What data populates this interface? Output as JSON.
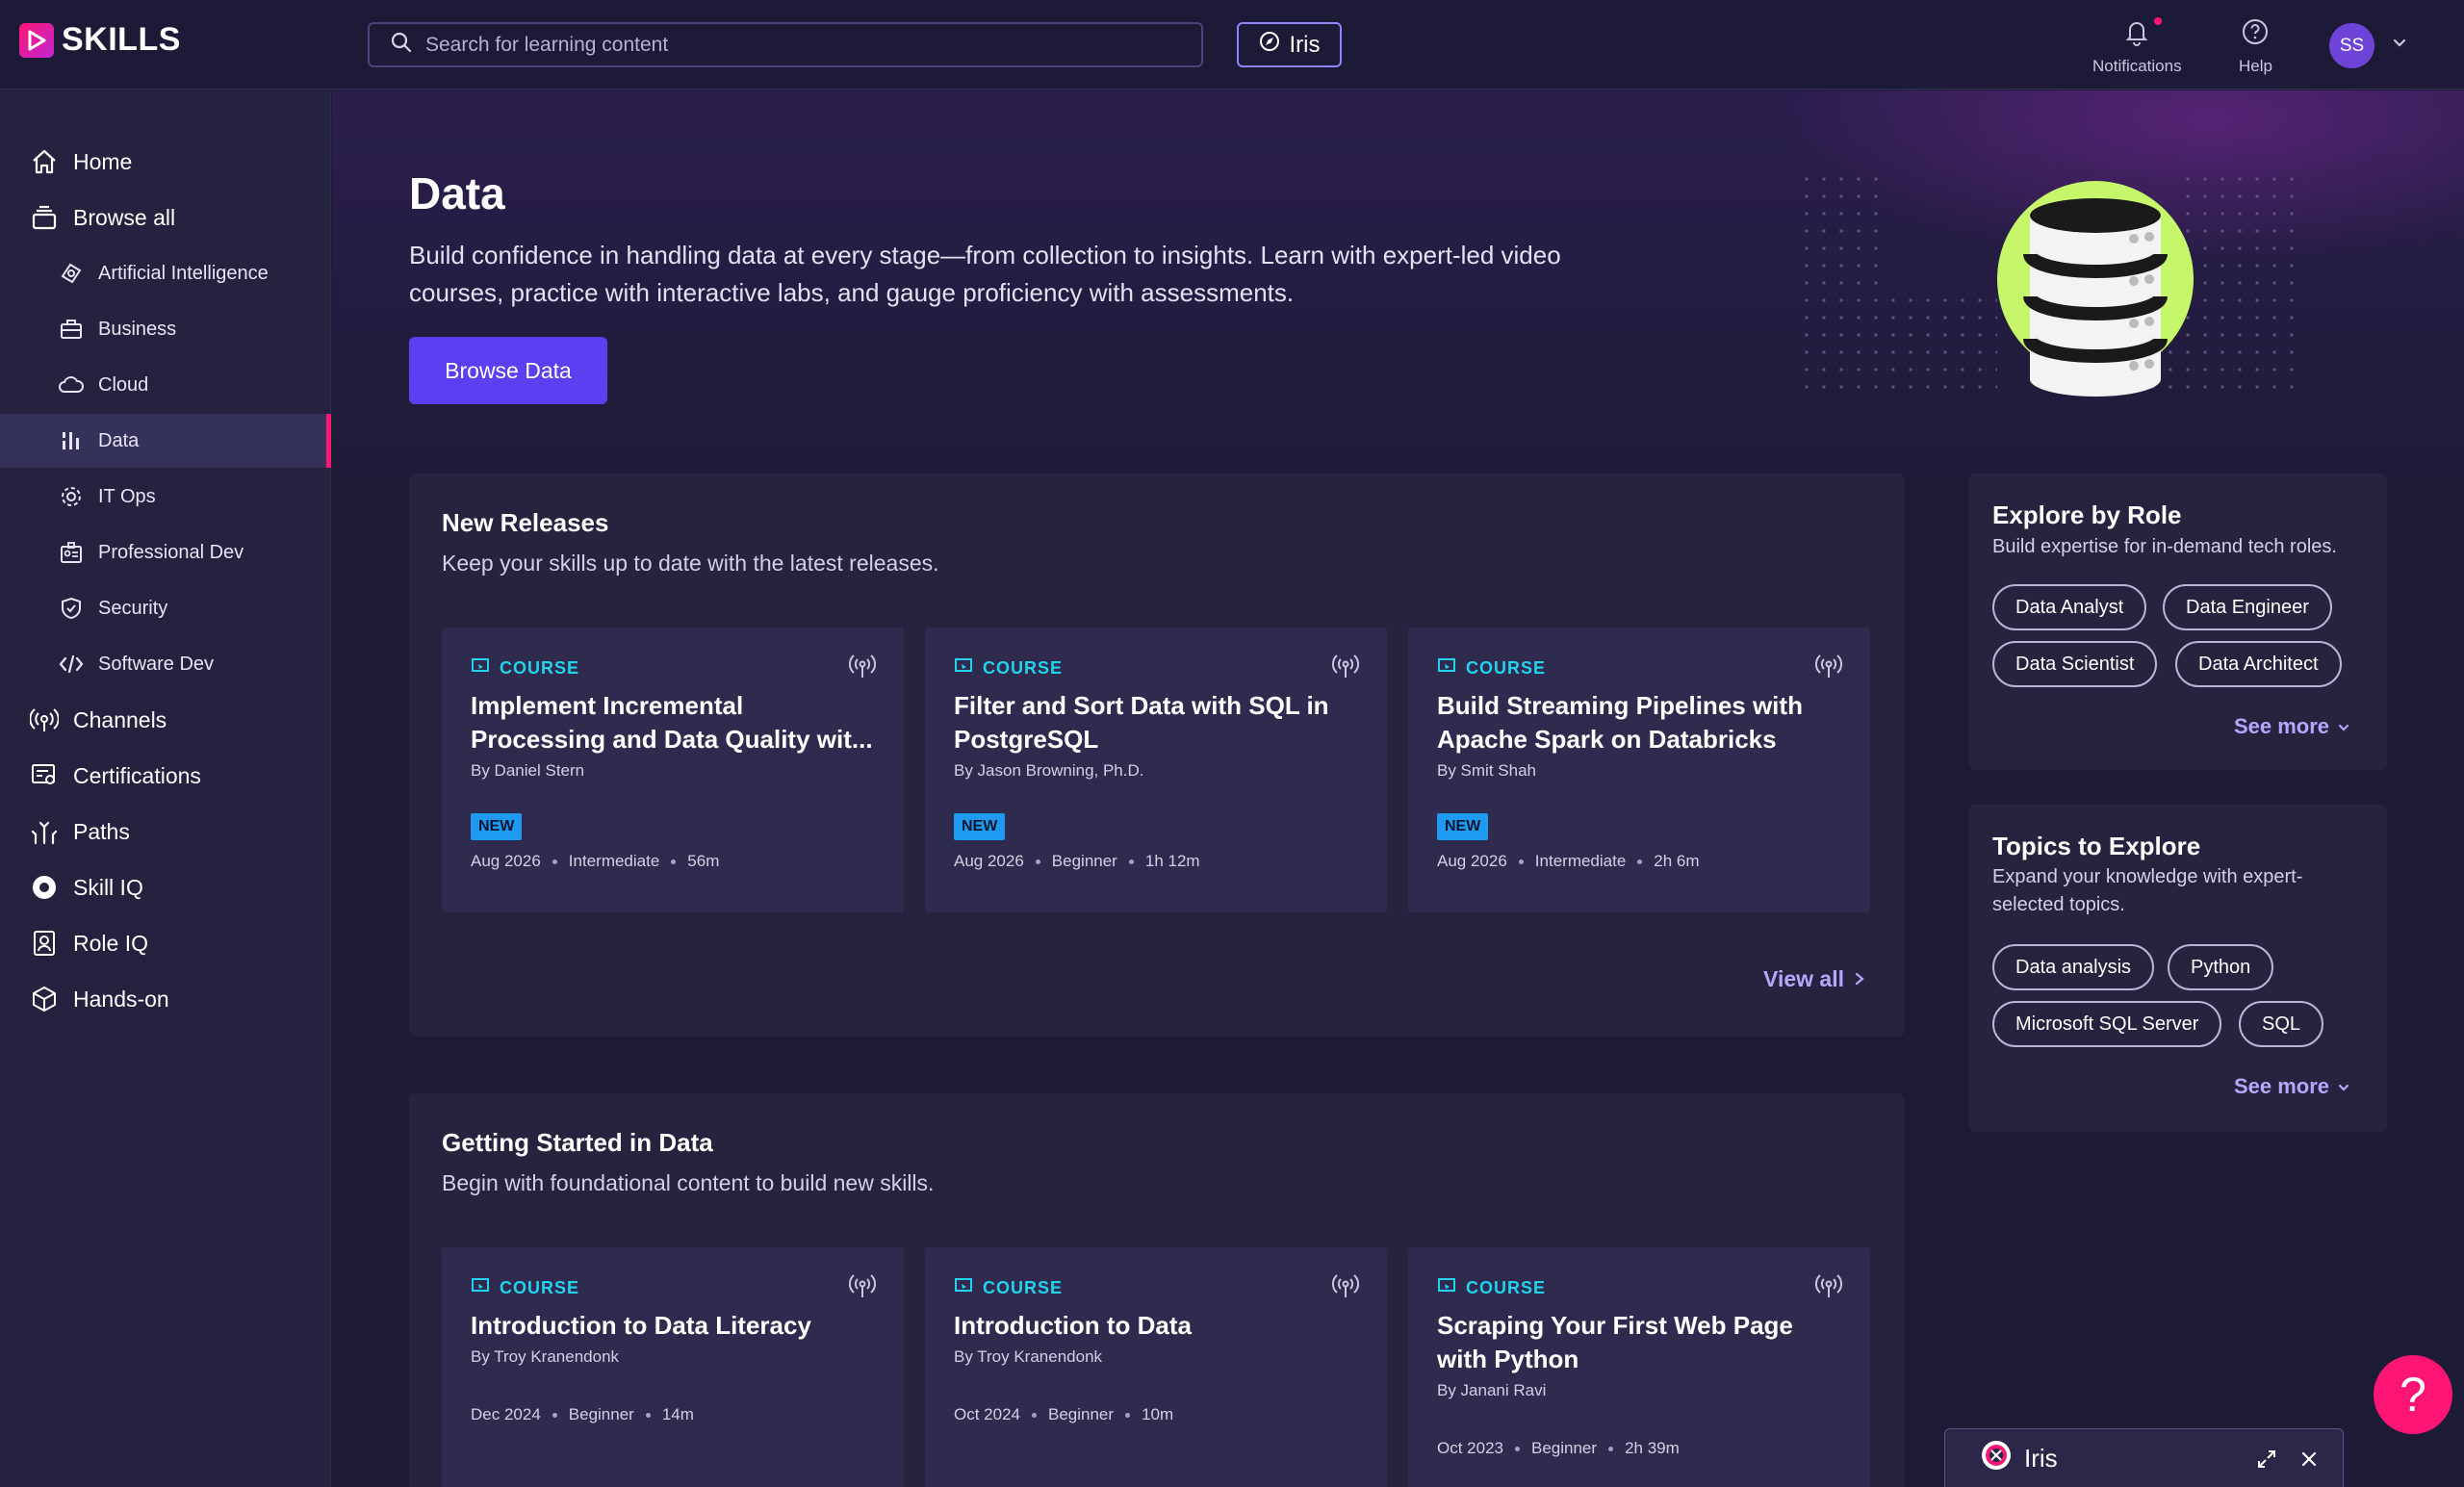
{
  "brand": {
    "name": "SKILLS"
  },
  "search": {
    "placeholder": "Search for learning content"
  },
  "iris_button": {
    "label": "Iris"
  },
  "top_actions": {
    "notifications": "Notifications",
    "help": "Help",
    "avatar_initials": "SS"
  },
  "sidebar": {
    "items": [
      {
        "label": "Home",
        "icon": "home-icon"
      },
      {
        "label": "Browse all",
        "icon": "stack-icon"
      },
      {
        "label": "Artificial Intelligence",
        "icon": "ai-icon"
      },
      {
        "label": "Business",
        "icon": "briefcase-icon"
      },
      {
        "label": "Cloud",
        "icon": "cloud-icon"
      },
      {
        "label": "Data",
        "icon": "data-bars-icon",
        "active": true
      },
      {
        "label": "IT Ops",
        "icon": "gear-icon"
      },
      {
        "label": "Professional Dev",
        "icon": "id-badge-icon"
      },
      {
        "label": "Security",
        "icon": "shield-icon"
      },
      {
        "label": "Software Dev",
        "icon": "code-icon"
      },
      {
        "label": "Channels",
        "icon": "broadcast-icon"
      },
      {
        "label": "Certifications",
        "icon": "certificate-icon"
      },
      {
        "label": "Paths",
        "icon": "paths-icon"
      },
      {
        "label": "Skill IQ",
        "icon": "skill-iq-icon"
      },
      {
        "label": "Role IQ",
        "icon": "role-iq-icon"
      },
      {
        "label": "Hands-on",
        "icon": "cube-icon"
      }
    ]
  },
  "hero": {
    "title": "Data",
    "description": "Build confidence in handling data at every stage—from collection to insights. Learn with expert-led video courses, practice with interactive labs, and gauge proficiency with assessments.",
    "button": "Browse Data"
  },
  "new_releases": {
    "title": "New Releases",
    "subtitle": "Keep your skills up to date with the latest releases.",
    "view_all": "View all",
    "cards": [
      {
        "type": "COURSE",
        "title": "Implement Incremental Processing and Data Quality wit...",
        "author": "By Daniel Stern",
        "badge": "NEW",
        "date": "Aug 2026",
        "level": "Intermediate",
        "duration": "56m"
      },
      {
        "type": "COURSE",
        "title": "Filter and Sort Data with SQL in PostgreSQL",
        "author": "By Jason Browning, Ph.D.",
        "badge": "NEW",
        "date": "Aug 2026",
        "level": "Beginner",
        "duration": "1h 12m"
      },
      {
        "type": "COURSE",
        "title": "Build Streaming Pipelines with Apache Spark on Databricks",
        "author": "By Smit Shah",
        "badge": "NEW",
        "date": "Aug 2026",
        "level": "Intermediate",
        "duration": "2h 6m"
      }
    ]
  },
  "getting_started": {
    "title": "Getting Started in Data",
    "subtitle": "Begin with foundational content to build new skills.",
    "cards": [
      {
        "type": "COURSE",
        "title": "Introduction to Data Literacy",
        "author": "By Troy Kranendonk",
        "date": "Dec 2024",
        "level": "Beginner",
        "duration": "14m"
      },
      {
        "type": "COURSE",
        "title": "Introduction to Data",
        "author": "By Troy Kranendonk",
        "date": "Oct 2024",
        "level": "Beginner",
        "duration": "10m"
      },
      {
        "type": "COURSE",
        "title": "Scraping Your First Web Page with Python",
        "author": "By Janani Ravi",
        "date": "Oct 2023",
        "level": "Beginner",
        "duration": "2h 39m"
      }
    ]
  },
  "explore_role": {
    "title": "Explore by Role",
    "subtitle": "Build expertise for in-demand tech roles.",
    "chips": [
      "Data Analyst",
      "Data Engineer",
      "Data Scientist",
      "Data Architect"
    ],
    "see_more": "See more"
  },
  "topics": {
    "title": "Topics to Explore",
    "subtitle": "Expand your knowledge with expert-selected topics.",
    "chips": [
      "Data analysis",
      "Python",
      "Microsoft SQL Server",
      "SQL"
    ],
    "see_more": "See more"
  },
  "help_fab": {
    "label": "?"
  },
  "iris_dock": {
    "label": "Iris"
  },
  "colors": {
    "accent": "#5b3ff0",
    "pink": "#ff1675",
    "cyan": "#22d3ee",
    "lime": "#c6f76a",
    "link": "#b2a9ff"
  }
}
